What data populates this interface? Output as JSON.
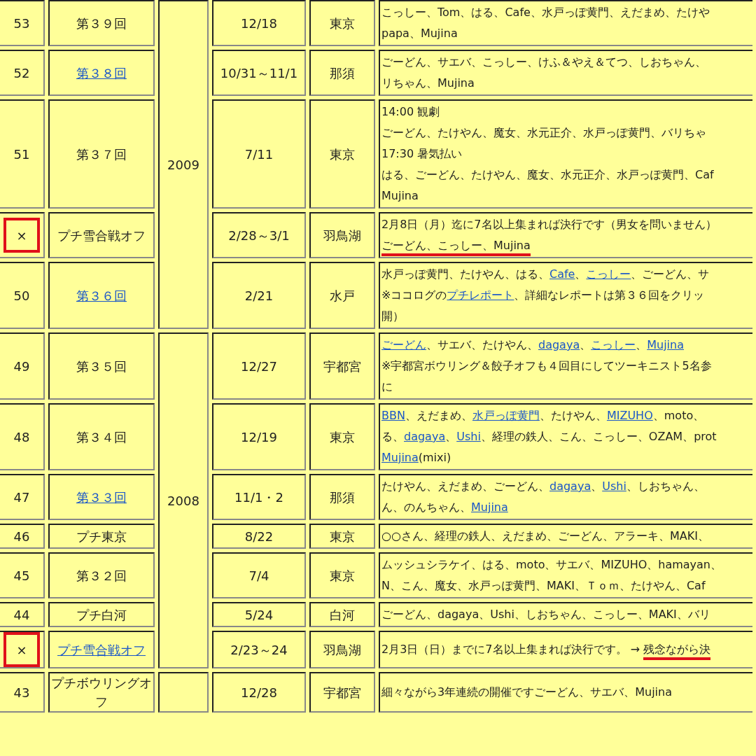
{
  "groups": [
    {
      "year": "2009",
      "rows": [
        {
          "no": "53",
          "marked": false,
          "title": {
            "text": "第３９回",
            "link": false
          },
          "date": "12/18",
          "place": "東京",
          "notes": [
            {
              "segments": [
                {
                  "text": "こっしー、Tom、はる、Cafe、水戸っぽ黄門、えだまめ、たけや",
                  "link": false,
                  "red_underline": false
                }
              ]
            },
            {
              "segments": [
                {
                  "text": "papa、Mujina",
                  "link": false,
                  "red_underline": false
                }
              ]
            }
          ]
        },
        {
          "no": "52",
          "marked": false,
          "title": {
            "text": "第３８回",
            "link": true
          },
          "date": "10/31～11/1",
          "place": "那須",
          "notes": [
            {
              "segments": [
                {
                  "text": "ごーどん、サエバ、こっしー、けふ＆やえ＆てつ、しおちゃん、",
                  "link": false,
                  "red_underline": false
                }
              ]
            },
            {
              "segments": [
                {
                  "text": "リちゃん、Mujina",
                  "link": false,
                  "red_underline": false
                }
              ]
            }
          ]
        },
        {
          "no": "51",
          "marked": false,
          "title": {
            "text": "第３７回",
            "link": false
          },
          "date": "7/11",
          "place": "東京",
          "notes": [
            {
              "segments": [
                {
                  "text": "14:00 観劇",
                  "link": false,
                  "red_underline": false
                }
              ]
            },
            {
              "segments": [
                {
                  "text": "ごーどん、たけやん、魔女、水元正介、水戸っぽ黄門、バリちゃ",
                  "link": false,
                  "red_underline": false
                }
              ]
            },
            {
              "segments": [
                {
                  "text": "17:30 暑気払い",
                  "link": false,
                  "red_underline": false
                }
              ]
            },
            {
              "segments": [
                {
                  "text": "はる、ごーどん、たけやん、魔女、水元正介、水戸っぽ黄門、Caf",
                  "link": false,
                  "red_underline": false
                }
              ]
            },
            {
              "segments": [
                {
                  "text": "Mujina",
                  "link": false,
                  "red_underline": false
                }
              ]
            }
          ]
        },
        {
          "no": "×",
          "marked": true,
          "title": {
            "text": "プチ雪合戦オフ",
            "link": false
          },
          "date": "2/28～3/1",
          "place": "羽鳥湖",
          "notes": [
            {
              "segments": [
                {
                  "text": "2月8日（月）迄に7名以上集まれば決行です（男女を問いません）",
                  "link": false,
                  "red_underline": false
                }
              ]
            },
            {
              "segments": [
                {
                  "text": "ごーどん、こっしー、Mujina",
                  "link": false,
                  "red_underline": true
                }
              ]
            }
          ]
        },
        {
          "no": "50",
          "marked": false,
          "title": {
            "text": "第３６回",
            "link": true
          },
          "date": "2/21",
          "place": "水戸",
          "notes": [
            {
              "segments": [
                {
                  "text": "水戸っぽ黄門、たけやん、はる、",
                  "link": false,
                  "red_underline": false
                },
                {
                  "text": "Cafe",
                  "link": true,
                  "red_underline": false
                },
                {
                  "text": "、",
                  "link": false,
                  "red_underline": false
                },
                {
                  "text": "こっしー",
                  "link": true,
                  "red_underline": false
                },
                {
                  "text": "、ごーどん、サ",
                  "link": false,
                  "red_underline": false
                }
              ]
            },
            {
              "segments": [
                {
                  "text": "※ココログの",
                  "link": false,
                  "red_underline": false
                },
                {
                  "text": "プチレポート",
                  "link": true,
                  "red_underline": false
                },
                {
                  "text": "、詳細なレポートは第３６回をクリッ",
                  "link": false,
                  "red_underline": false
                }
              ]
            },
            {
              "segments": [
                {
                  "text": "開）",
                  "link": false,
                  "red_underline": false
                }
              ]
            }
          ]
        }
      ]
    },
    {
      "year": "2008",
      "rows": [
        {
          "no": "49",
          "marked": false,
          "title": {
            "text": "第３５回",
            "link": false
          },
          "date": "12/27",
          "place": "宇都宮",
          "notes": [
            {
              "segments": [
                {
                  "text": "ごーどん",
                  "link": true,
                  "red_underline": false
                },
                {
                  "text": "、サエバ、たけやん、",
                  "link": false,
                  "red_underline": false
                },
                {
                  "text": "dagaya",
                  "link": true,
                  "red_underline": false
                },
                {
                  "text": "、",
                  "link": false,
                  "red_underline": false
                },
                {
                  "text": "こっしー",
                  "link": true,
                  "red_underline": false
                },
                {
                  "text": "、",
                  "link": false,
                  "red_underline": false
                },
                {
                  "text": "Mujina",
                  "link": true,
                  "red_underline": false
                }
              ]
            },
            {
              "segments": [
                {
                  "text": "※宇都宮ボウリング＆餃子オフも４回目にしてツーキニスト5名参",
                  "link": false,
                  "red_underline": false
                }
              ]
            },
            {
              "segments": [
                {
                  "text": "に",
                  "link": false,
                  "red_underline": false
                }
              ]
            }
          ]
        },
        {
          "no": "48",
          "marked": false,
          "title": {
            "text": "第３４回",
            "link": false
          },
          "date": "12/19",
          "place": "東京",
          "notes": [
            {
              "segments": [
                {
                  "text": "BBN",
                  "link": true,
                  "red_underline": false
                },
                {
                  "text": "、えだまめ、",
                  "link": false,
                  "red_underline": false
                },
                {
                  "text": "水戸っぽ黄門",
                  "link": true,
                  "red_underline": false
                },
                {
                  "text": "、たけやん、",
                  "link": false,
                  "red_underline": false
                },
                {
                  "text": "MIZUHO",
                  "link": true,
                  "red_underline": false
                },
                {
                  "text": "、moto、",
                  "link": false,
                  "red_underline": false
                }
              ]
            },
            {
              "segments": [
                {
                  "text": "る、",
                  "link": false,
                  "red_underline": false
                },
                {
                  "text": "dagaya",
                  "link": true,
                  "red_underline": false
                },
                {
                  "text": "、",
                  "link": false,
                  "red_underline": false
                },
                {
                  "text": "Ushi",
                  "link": true,
                  "red_underline": false
                },
                {
                  "text": "、経理の鉄人、こん、こっしー、OZAM、prot",
                  "link": false,
                  "red_underline": false
                }
              ]
            },
            {
              "segments": [
                {
                  "text": "Mujina",
                  "link": true,
                  "red_underline": false
                },
                {
                  "text": "(mixi)",
                  "link": false,
                  "red_underline": false
                }
              ]
            }
          ]
        },
        {
          "no": "47",
          "marked": false,
          "title": {
            "text": "第３３回",
            "link": true
          },
          "date": "11/1・2",
          "place": "那須",
          "notes": [
            {
              "segments": [
                {
                  "text": "たけやん、えだまめ、ごーどん、",
                  "link": false,
                  "red_underline": false
                },
                {
                  "text": "dagaya",
                  "link": true,
                  "red_underline": false
                },
                {
                  "text": "、",
                  "link": false,
                  "red_underline": false
                },
                {
                  "text": "Ushi",
                  "link": true,
                  "red_underline": false
                },
                {
                  "text": "、しおちゃん、",
                  "link": false,
                  "red_underline": false
                }
              ]
            },
            {
              "segments": [
                {
                  "text": "ん、のんちゃん、",
                  "link": false,
                  "red_underline": false
                },
                {
                  "text": "Mujina",
                  "link": true,
                  "red_underline": false
                }
              ]
            }
          ]
        },
        {
          "no": "46",
          "marked": false,
          "title": {
            "text": "プチ東京",
            "link": false
          },
          "date": "8/22",
          "place": "東京",
          "notes": [
            {
              "segments": [
                {
                  "text": "○○さん、経理の鉄人、えだまめ、ごーどん、アラーキ、MAKI、",
                  "link": false,
                  "red_underline": false
                }
              ]
            }
          ]
        },
        {
          "no": "45",
          "marked": false,
          "title": {
            "text": "第３２回",
            "link": false
          },
          "date": "7/4",
          "place": "東京",
          "notes": [
            {
              "segments": [
                {
                  "text": "ムッシュシラケイ、はる、moto、サエバ、MIZUHO、hamayan、",
                  "link": false,
                  "red_underline": false
                }
              ]
            },
            {
              "segments": [
                {
                  "text": "N、こん、魔女、水戸っぽ黄門、MAKI、Ｔｏｍ、たけやん、Caf",
                  "link": false,
                  "red_underline": false
                }
              ]
            }
          ]
        },
        {
          "no": "44",
          "marked": false,
          "title": {
            "text": "プチ白河",
            "link": false
          },
          "date": "5/24",
          "place": "白河",
          "notes": [
            {
              "segments": [
                {
                  "text": "ごーどん、dagaya、Ushi、しおちゃん、こっしー、MAKI、バリ",
                  "link": false,
                  "red_underline": false
                }
              ]
            }
          ]
        },
        {
          "no": "×",
          "marked": true,
          "title": {
            "text": "プチ雪合戦オフ",
            "link": true
          },
          "date": "2/23～24",
          "place": "羽鳥湖",
          "notes": [
            {
              "segments": [
                {
                  "text": "2月3日（日）までに7名以上集まれば決行です。 → ",
                  "link": false,
                  "red_underline": false
                },
                {
                  "text": "残念ながら決",
                  "link": false,
                  "red_underline": true
                }
              ]
            }
          ]
        }
      ]
    },
    {
      "rows": [
        {
          "no": "43",
          "marked": false,
          "title": {
            "text": "プチボウリングオフ",
            "link": false
          },
          "date": "12/28",
          "place": "宇都宮",
          "notes": [
            {
              "segments": [
                {
                  "text": "細々ながら3年連続の開催ですごーどん、サエバ、Mujina",
                  "link": false,
                  "red_underline": false
                }
              ]
            }
          ]
        }
      ]
    }
  ]
}
